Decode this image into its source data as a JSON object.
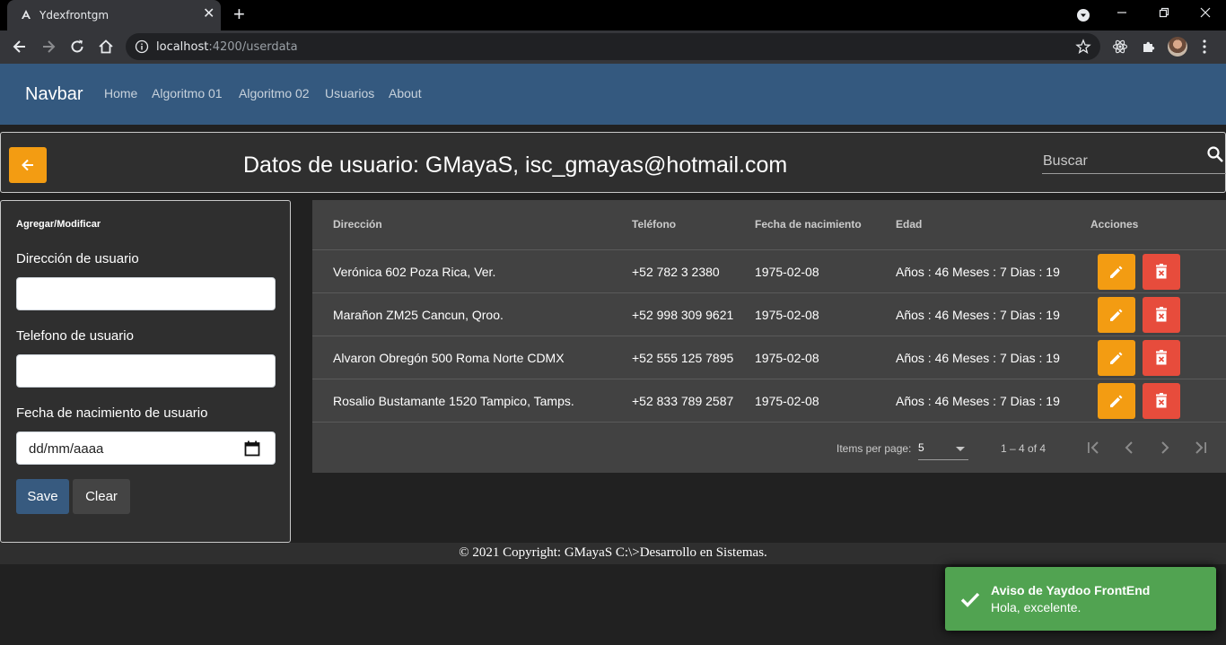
{
  "browser": {
    "tab_title": "Ydexfrontgm",
    "url_host": "localhost",
    "url_path": ":4200/userdata"
  },
  "navbar": {
    "brand": "Navbar",
    "links": [
      "Home",
      "Algoritmo 01",
      "Algoritmo 02",
      "Usuarios",
      "About"
    ]
  },
  "header": {
    "title": "Datos de usuario: GMayaS, isc_gmayas@hotmail.com",
    "search_placeholder": "Buscar"
  },
  "form": {
    "heading": "Agregar/Modificar",
    "address_label": "Dirección de usuario",
    "address_value": "",
    "phone_label": "Telefono de usuario",
    "phone_value": "",
    "birth_label": "Fecha de nacimiento de usuario",
    "birth_placeholder": "dd/mm/aaaa",
    "save_label": "Save",
    "clear_label": "Clear"
  },
  "table": {
    "headers": [
      "Dirección",
      "Teléfono",
      "Fecha de nacimiento",
      "Edad",
      "Acciones"
    ],
    "rows": [
      {
        "address": "Verónica 602 Poza Rica, Ver.",
        "phone": "+52 782 3 2380",
        "birth": "1975-02-08",
        "age": "Años : 46 Meses : 7 Dias : 19"
      },
      {
        "address": "Marañon ZM25 Cancun, Qroo.",
        "phone": "+52 998 309 9621",
        "birth": "1975-02-08",
        "age": "Años : 46 Meses : 7 Dias : 19"
      },
      {
        "address": "Alvaron Obregón 500 Roma Norte CDMX",
        "phone": "+52 555 125 7895",
        "birth": "1975-02-08",
        "age": "Años : 46 Meses : 7 Dias : 19"
      },
      {
        "address": "Rosalio Bustamante 1520 Tampico, Tamps.",
        "phone": "+52 833 789 2587",
        "birth": "1975-02-08",
        "age": "Años : 46 Meses : 7 Dias : 19"
      }
    ]
  },
  "paginator": {
    "items_label": "Items per page:",
    "page_size": "5",
    "range": "1 – 4 of 4"
  },
  "footer": {
    "text": "© 2021 Copyright: GMayaS C:\\>Desarrollo en Sistemas."
  },
  "toast": {
    "title": "Aviso de Yaydoo FrontEnd",
    "message": "Hola, excelente."
  },
  "colors": {
    "navbar": "#34597f",
    "accent_orange": "#f39c12",
    "danger_red": "#e74c3c",
    "success_green": "#51a351",
    "primary_blue": "#375a7f"
  }
}
